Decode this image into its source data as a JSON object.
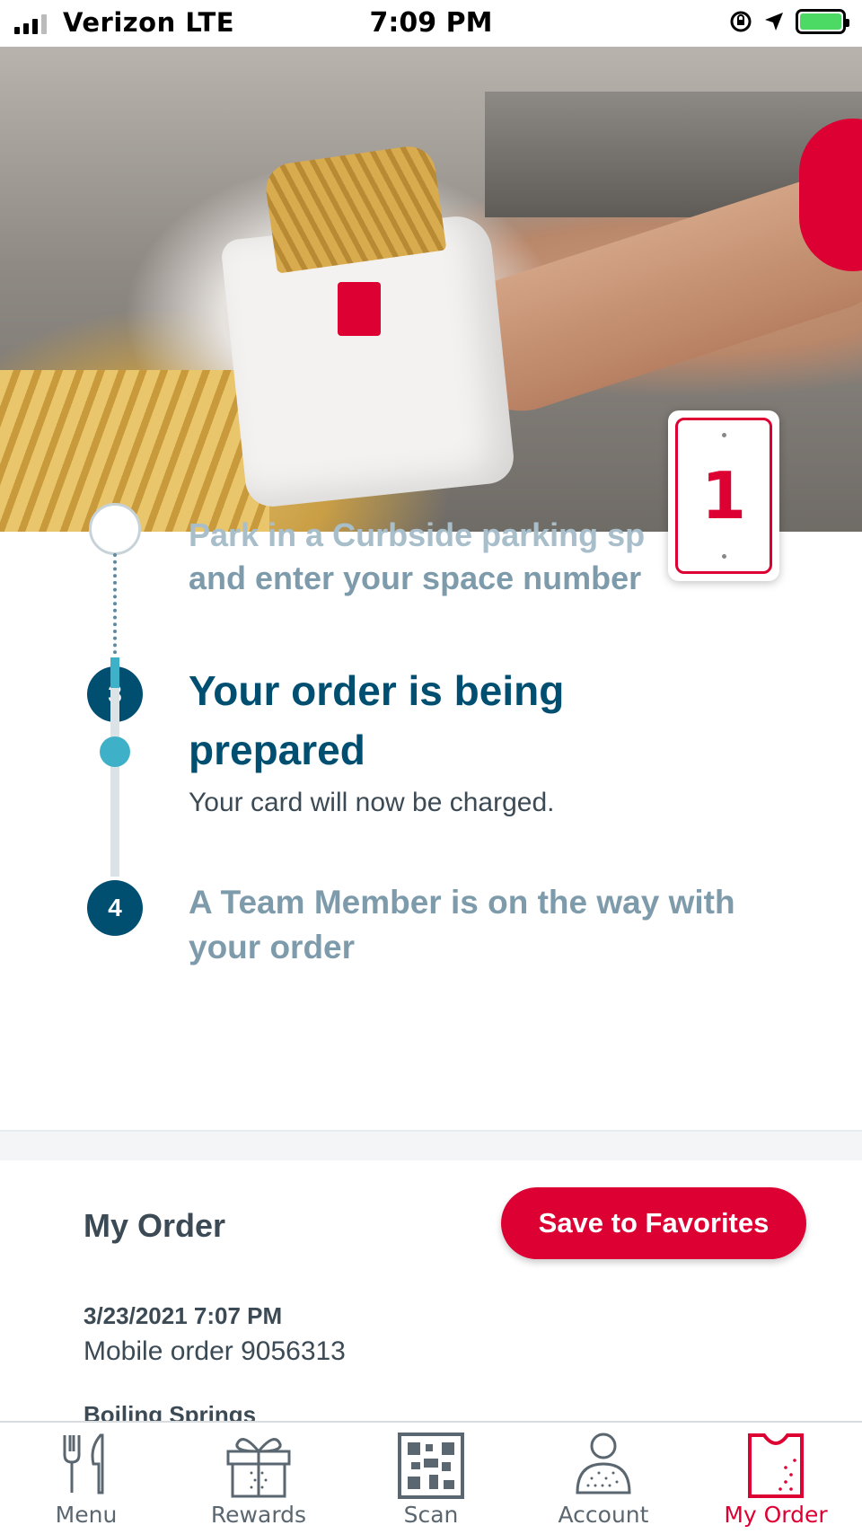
{
  "status_bar": {
    "carrier": "Verizon  LTE",
    "time": "7:09 PM",
    "icons": [
      "signal-icon",
      "screen-rotation-lock-icon",
      "location-arrow-icon",
      "battery-charging-icon"
    ]
  },
  "hero": {
    "space_number": "1"
  },
  "steps": {
    "step2_text_line1": "Park in a Curbside parking sp",
    "step2_text_line2": "and enter your space number",
    "step3_number": "3",
    "step3_title": "Your order is being prepared",
    "step3_description": "Your card will now be charged.",
    "step4_number": "4",
    "step4_title": "A Team Member is on the way with your order",
    "progress_fraction": 0.14
  },
  "order": {
    "title": "My Order",
    "save_button": "Save to Favorites",
    "date": "3/23/2021 7:07 PM",
    "order_number": "Mobile order 9056313",
    "location": "Boiling Springs"
  },
  "tab_bar": {
    "items": [
      {
        "label": "Menu",
        "icon": "fork-knife-icon"
      },
      {
        "label": "Rewards",
        "icon": "gift-icon"
      },
      {
        "label": "Scan",
        "icon": "qr-code-icon"
      },
      {
        "label": "Account",
        "icon": "person-icon"
      },
      {
        "label": "My Order",
        "icon": "bag-icon"
      }
    ],
    "active": "My Order"
  },
  "colors": {
    "brand_red": "#dd0033",
    "navy": "#004f71",
    "teal": "#3eb1c8",
    "muted_blue": "#7d9bab"
  }
}
